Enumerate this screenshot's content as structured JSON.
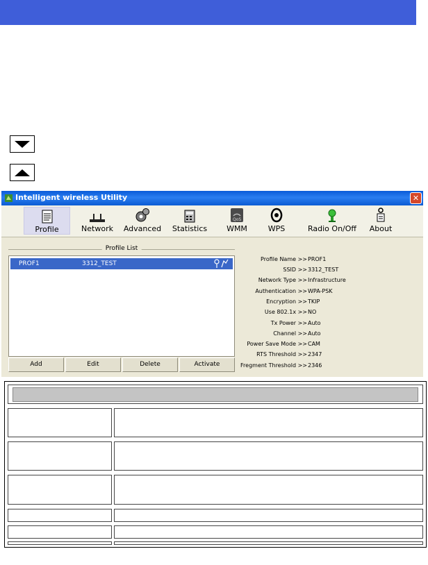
{
  "window": {
    "title": "Intelligent wireless Utility",
    "close_label": "✕"
  },
  "toolbar": {
    "items": [
      {
        "label": "Profile",
        "icon": "profile-icon"
      },
      {
        "label": "Network",
        "icon": "network-icon"
      },
      {
        "label": "Advanced",
        "icon": "advanced-icon"
      },
      {
        "label": "Statistics",
        "icon": "statistics-icon"
      },
      {
        "label": "WMM",
        "icon": "wmm-icon"
      },
      {
        "label": "WPS",
        "icon": "wps-icon"
      },
      {
        "label": "Radio On/Off",
        "icon": "radio-icon"
      },
      {
        "label": "About",
        "icon": "about-icon"
      }
    ]
  },
  "profile_list": {
    "heading": "Profile List",
    "rows": [
      {
        "profile": "PROF1",
        "ssid": "3312_TEST"
      }
    ],
    "buttons": {
      "add": "Add",
      "edit": "Edit",
      "delete": "Delete",
      "activate": "Activate"
    }
  },
  "details": {
    "rows": [
      {
        "label": "Profile Name >>",
        "value": "PROF1"
      },
      {
        "label": "SSID >>",
        "value": "3312_TEST"
      },
      {
        "label": "Network Type >>",
        "value": "Infrastructure"
      },
      {
        "label": "Authentication >>",
        "value": "WPA-PSK"
      },
      {
        "label": "Encryption >>",
        "value": "TKIP"
      },
      {
        "label": "Use 802.1x >>",
        "value": "NO"
      },
      {
        "label": "Tx Power >>",
        "value": "Auto"
      },
      {
        "label": "Channel >>",
        "value": "Auto"
      },
      {
        "label": "Power Save Mode >>",
        "value": "CAM"
      },
      {
        "label": "RTS Threshold >>",
        "value": "2347"
      },
      {
        "label": "Fregment Threshold >>",
        "value": "2346"
      }
    ]
  },
  "colors": {
    "topbar": "#3f5ed9",
    "selection": "#3a67c8"
  }
}
